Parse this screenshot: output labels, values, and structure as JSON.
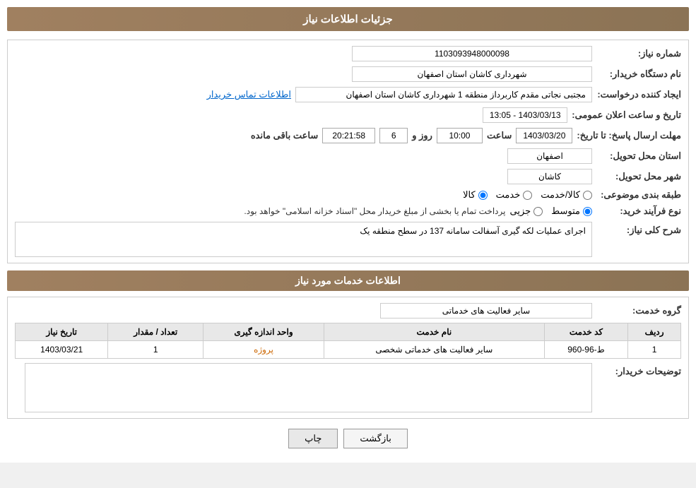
{
  "page": {
    "title": "جزئیات اطلاعات نیاز",
    "header": "جزئیات اطلاعات نیاز"
  },
  "fields": {
    "need_number_label": "شماره نیاز:",
    "need_number_value": "1103093948000098",
    "buyer_org_label": "نام دستگاه خریدار:",
    "buyer_org_value": "شهرداری کاشان استان اصفهان",
    "creator_label": "ایجاد کننده درخواست:",
    "creator_value": "مجتبی نجاتی مقدم کاربرداز منطقه 1 شهرداری کاشان استان اصفهان",
    "contact_link": "اطلاعات تماس خریدار",
    "announce_label": "تاریخ و ساعت اعلان عمومی:",
    "announce_value": "1403/03/13 - 13:05",
    "deadline_label": "مهلت ارسال پاسخ: تا تاریخ:",
    "deadline_date": "1403/03/20",
    "deadline_time_label": "ساعت",
    "deadline_time_value": "10:00",
    "deadline_days_label": "روز و",
    "deadline_days_value": "6",
    "deadline_remain_label": "ساعت باقی مانده",
    "deadline_remain_value": "20:21:58",
    "province_label": "استان محل تحویل:",
    "province_value": "اصفهان",
    "city_label": "شهر محل تحویل:",
    "city_value": "کاشان",
    "category_label": "طبقه بندی موضوعی:",
    "category_options": [
      "کالا",
      "خدمت",
      "کالا/خدمت"
    ],
    "category_selected": "کالا",
    "purchase_type_label": "نوع فرآیند خرید:",
    "purchase_options": [
      "جزیی",
      "متوسط"
    ],
    "purchase_selected": "متوسط",
    "purchase_note": "پرداخت تمام یا بخشی از مبلغ خریدار محل \"اسناد خزانه اسلامی\" خواهد بود.",
    "need_desc_label": "شرح کلی نیاز:",
    "need_desc_value": "اجرای عملیات لکه گیری آسفالت سامانه 137 در سطح منطقه یک",
    "services_section_title": "اطلاعات خدمات مورد نیاز",
    "service_group_label": "گروه خدمت:",
    "service_group_value": "سایر فعالیت های خدماتی",
    "table": {
      "headers": [
        "ردیف",
        "کد خدمت",
        "نام خدمت",
        "واحد اندازه گیری",
        "تعداد / مقدار",
        "تاریخ نیاز"
      ],
      "rows": [
        {
          "row": "1",
          "code": "ط-96-960",
          "name": "سایر فعالیت های خدماتی شخصی",
          "unit": "پروژه",
          "quantity": "1",
          "date": "1403/03/21"
        }
      ]
    },
    "buyer_desc_label": "توضیحات خریدار:",
    "buyer_desc_value": "",
    "buttons": {
      "back": "بازگشت",
      "print": "چاپ"
    }
  }
}
